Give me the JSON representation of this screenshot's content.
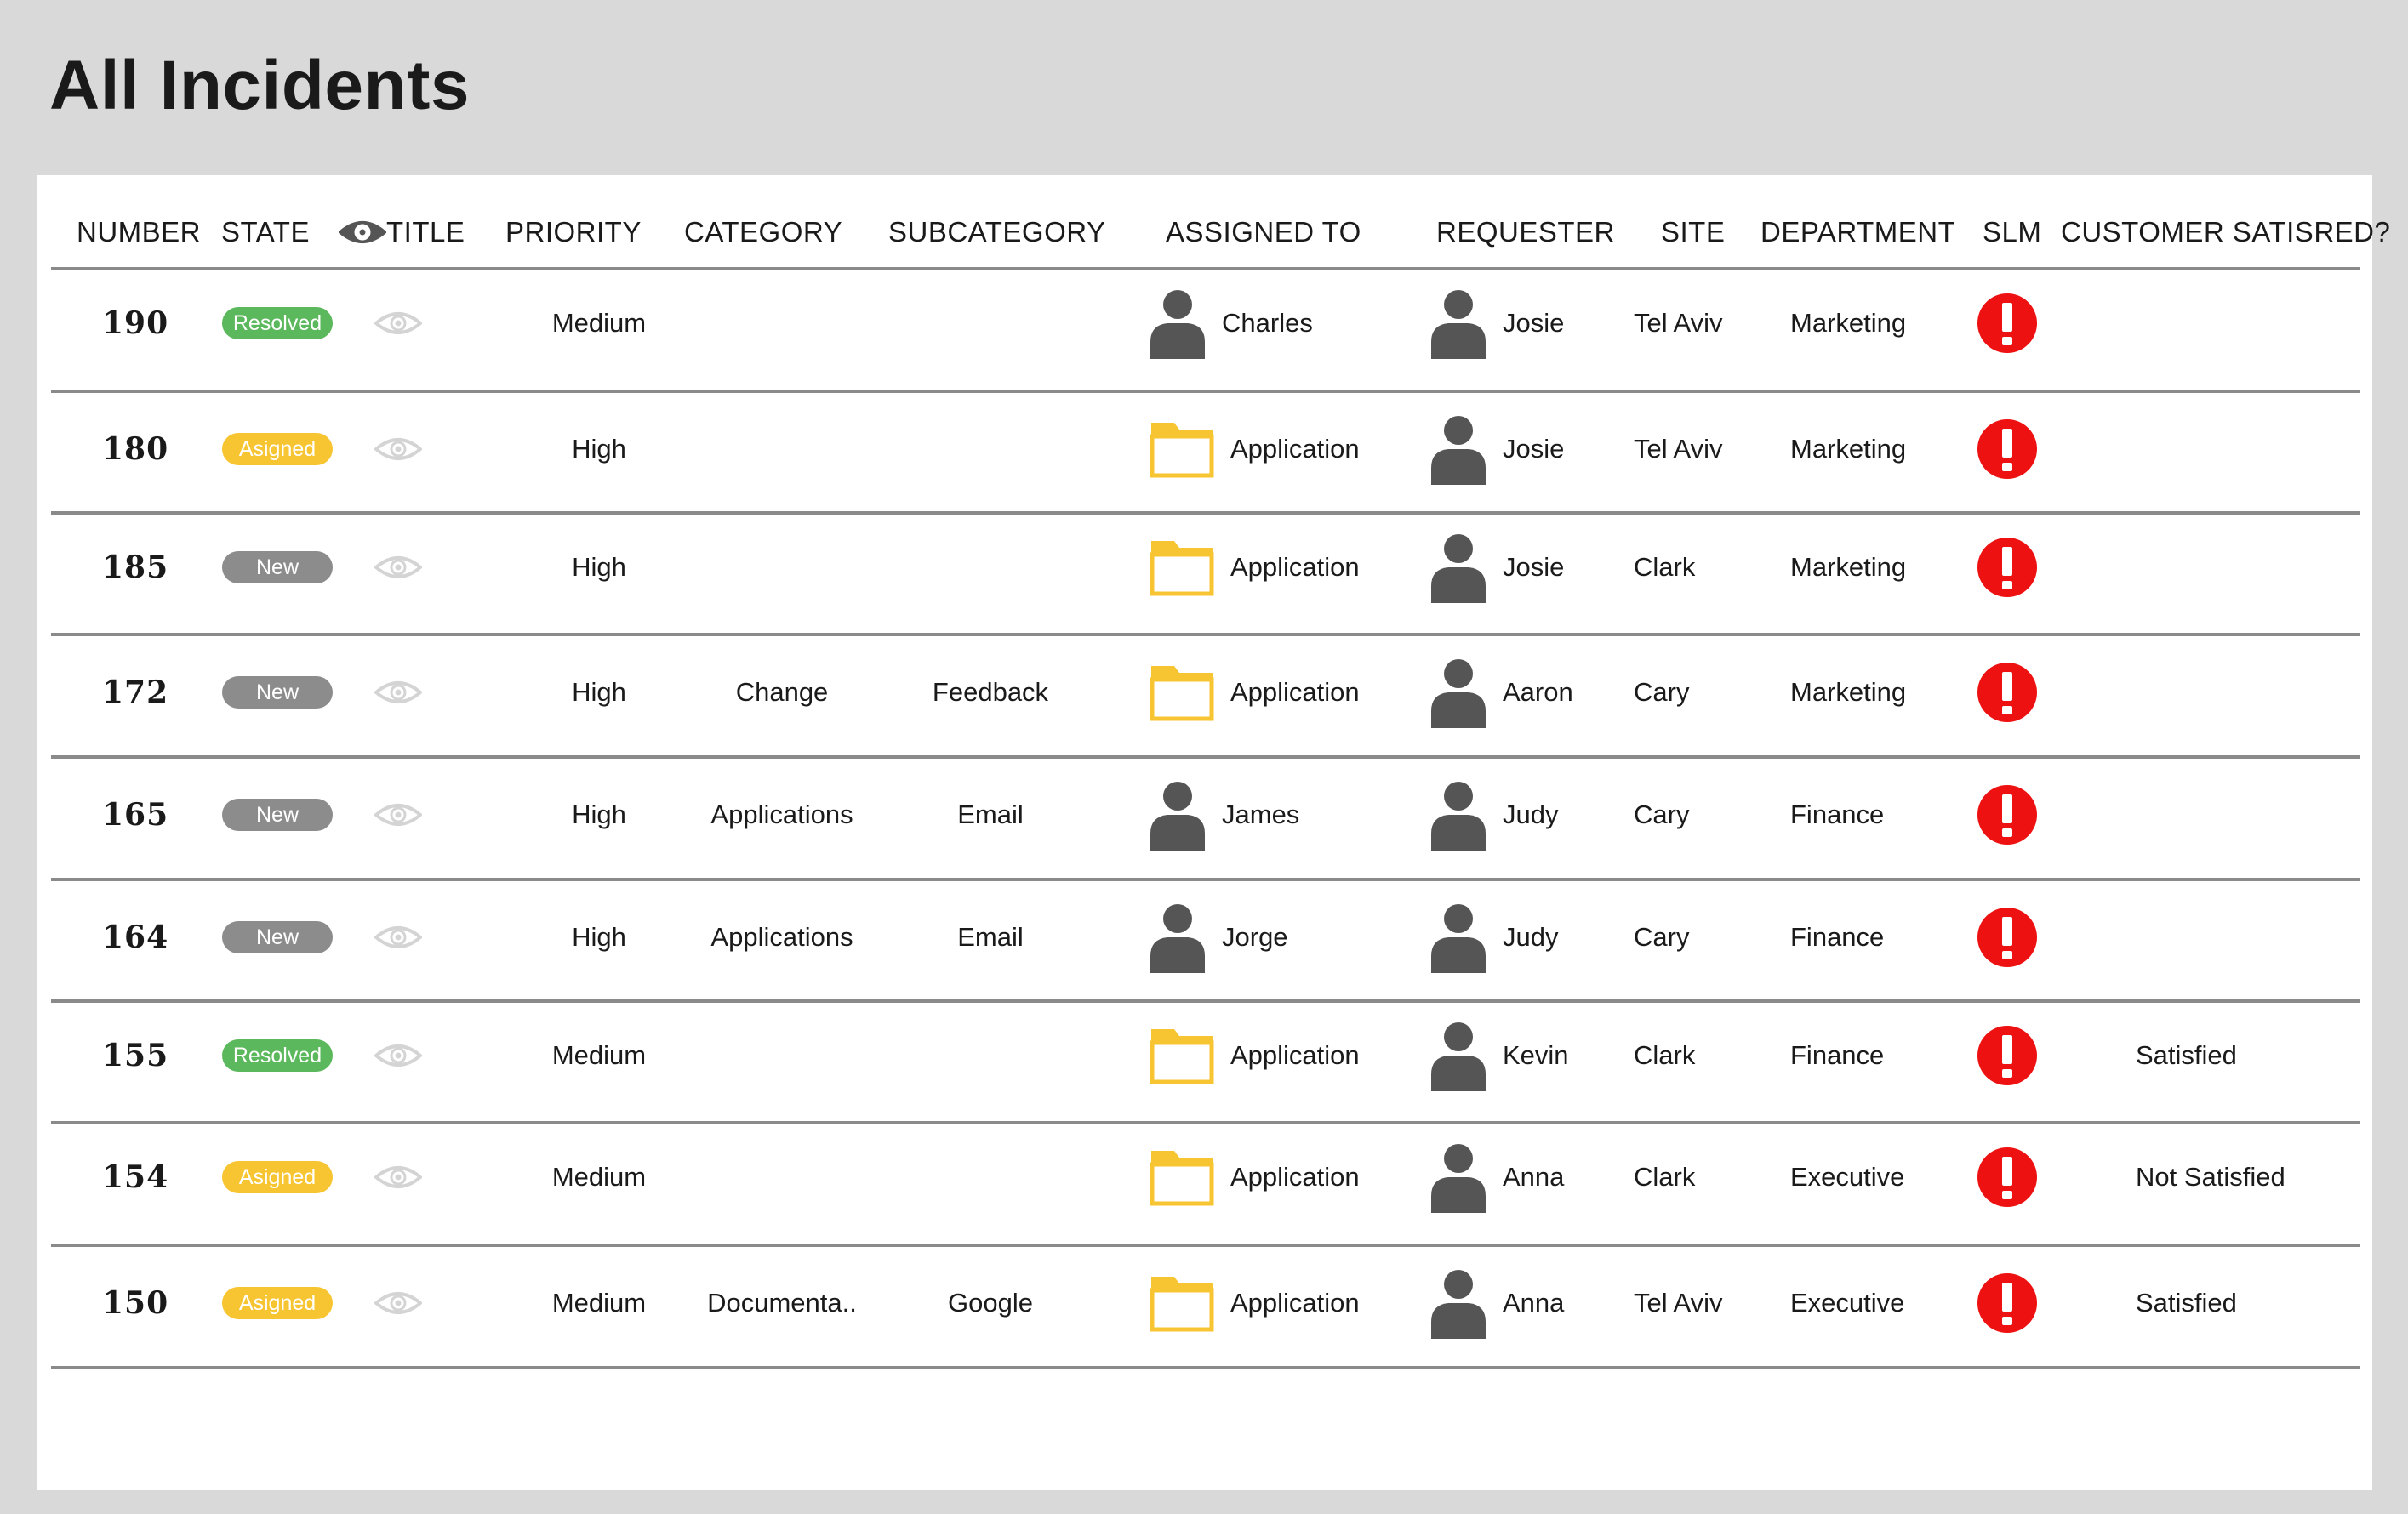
{
  "page_title": "All Incidents",
  "colors": {
    "resolved": "#5cb85c",
    "assigned": "#f7c531",
    "new": "#8c8c8c",
    "folder": "#f7c531",
    "person": "#555555",
    "alert": "#ee1111"
  },
  "columns": [
    "NUMBER",
    "STATE",
    "TITLE",
    "PRIORITY",
    "CATEGORY",
    "SUBCATEGORY",
    "ASSIGNED TO",
    "REQUESTER",
    "SITE",
    "DEPARTMENT",
    "SLM",
    "CUSTOMER SATISRED?"
  ],
  "title_header_icon": "eye-icon",
  "rows": [
    {
      "number": "190",
      "state": "Resolved",
      "state_color": "resolved",
      "priority": "Medium",
      "category": "",
      "subcategory": "",
      "assigned_icon": "person-icon",
      "assigned_to": "Charles",
      "requester": "Josie",
      "site": "Tel Aviv",
      "department": "Marketing",
      "slm_icon": "alert-icon",
      "satisfaction": ""
    },
    {
      "number": "180",
      "state": "Asigned",
      "state_color": "assigned",
      "priority": "High",
      "category": "",
      "subcategory": "",
      "assigned_icon": "folder-icon",
      "assigned_to": "Application",
      "requester": "Josie",
      "site": "Tel Aviv",
      "department": "Marketing",
      "slm_icon": "alert-icon",
      "satisfaction": ""
    },
    {
      "number": "185",
      "state": "New",
      "state_color": "new",
      "priority": "High",
      "category": "",
      "subcategory": "",
      "assigned_icon": "folder-icon",
      "assigned_to": "Application",
      "requester": "Josie",
      "site": "Clark",
      "department": "Marketing",
      "slm_icon": "alert-icon",
      "satisfaction": ""
    },
    {
      "number": "172",
      "state": "New",
      "state_color": "new",
      "priority": "High",
      "category": "Change",
      "subcategory": "Feedback",
      "assigned_icon": "folder-icon",
      "assigned_to": "Application",
      "requester": "Aaron",
      "site": "Cary",
      "department": "Marketing",
      "slm_icon": "alert-icon",
      "satisfaction": ""
    },
    {
      "number": "165",
      "state": "New",
      "state_color": "new",
      "priority": "High",
      "category": "Applications",
      "subcategory": "Email",
      "assigned_icon": "person-icon",
      "assigned_to": "James",
      "requester": "Judy",
      "site": "Cary",
      "department": "Finance",
      "slm_icon": "alert-icon",
      "satisfaction": ""
    },
    {
      "number": "164",
      "state": "New",
      "state_color": "new",
      "priority": "High",
      "category": "Applications",
      "subcategory": "Email",
      "assigned_icon": "person-icon",
      "assigned_to": "Jorge",
      "requester": "Judy",
      "site": "Cary",
      "department": "Finance",
      "slm_icon": "alert-icon",
      "satisfaction": ""
    },
    {
      "number": "155",
      "state": "Resolved",
      "state_color": "resolved",
      "priority": "Medium",
      "category": "",
      "subcategory": "",
      "assigned_icon": "folder-icon",
      "assigned_to": "Application",
      "requester": "Kevin",
      "site": "Clark",
      "department": "Finance",
      "slm_icon": "alert-icon",
      "satisfaction": "Satisfied"
    },
    {
      "number": "154",
      "state": "Asigned",
      "state_color": "assigned",
      "priority": "Medium",
      "category": "",
      "subcategory": "",
      "assigned_icon": "folder-icon",
      "assigned_to": "Application",
      "requester": "Anna",
      "site": "Clark",
      "department": "Executive",
      "slm_icon": "alert-icon",
      "satisfaction": "Not Satisfied"
    },
    {
      "number": "150",
      "state": "Asigned",
      "state_color": "assigned",
      "priority": "Medium",
      "category": "Documenta..",
      "subcategory": "Google",
      "assigned_icon": "folder-icon",
      "assigned_to": "Application",
      "requester": "Anna",
      "site": "Tel Aviv",
      "department": "Executive",
      "slm_icon": "alert-icon",
      "satisfaction": "Satisfied"
    }
  ]
}
